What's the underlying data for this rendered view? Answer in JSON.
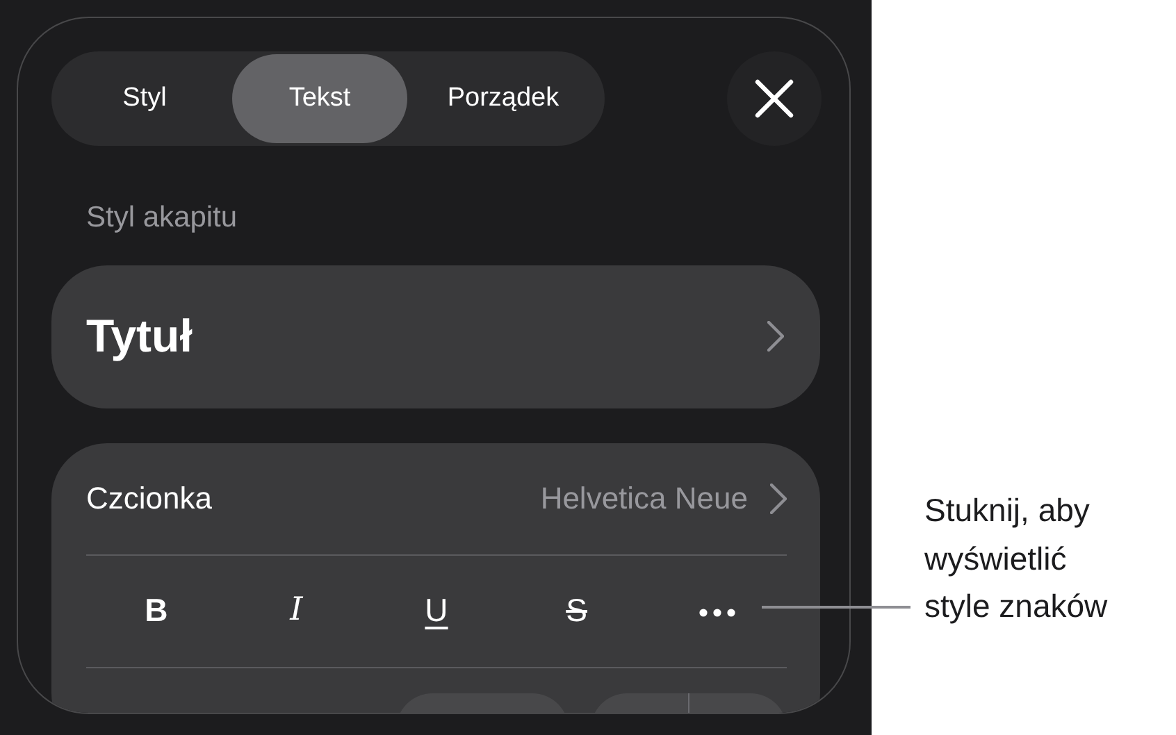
{
  "tabs": [
    {
      "label": "Styl",
      "selected": false
    },
    {
      "label": "Tekst",
      "selected": true
    },
    {
      "label": "Porządek",
      "selected": false
    }
  ],
  "paragraph_style": {
    "heading": "Styl akapitu",
    "value": "Tytuł"
  },
  "font": {
    "label": "Czcionka",
    "value": "Helvetica Neue"
  },
  "format_buttons": [
    {
      "kind": "bold",
      "label": "B"
    },
    {
      "kind": "italic",
      "label": "I"
    },
    {
      "kind": "underline",
      "label": "U"
    },
    {
      "kind": "strikethrough",
      "label": "S"
    },
    {
      "kind": "more"
    }
  ],
  "callout": {
    "lines": [
      "Stuknij, aby",
      "wyświetlić",
      "style znaków"
    ]
  }
}
